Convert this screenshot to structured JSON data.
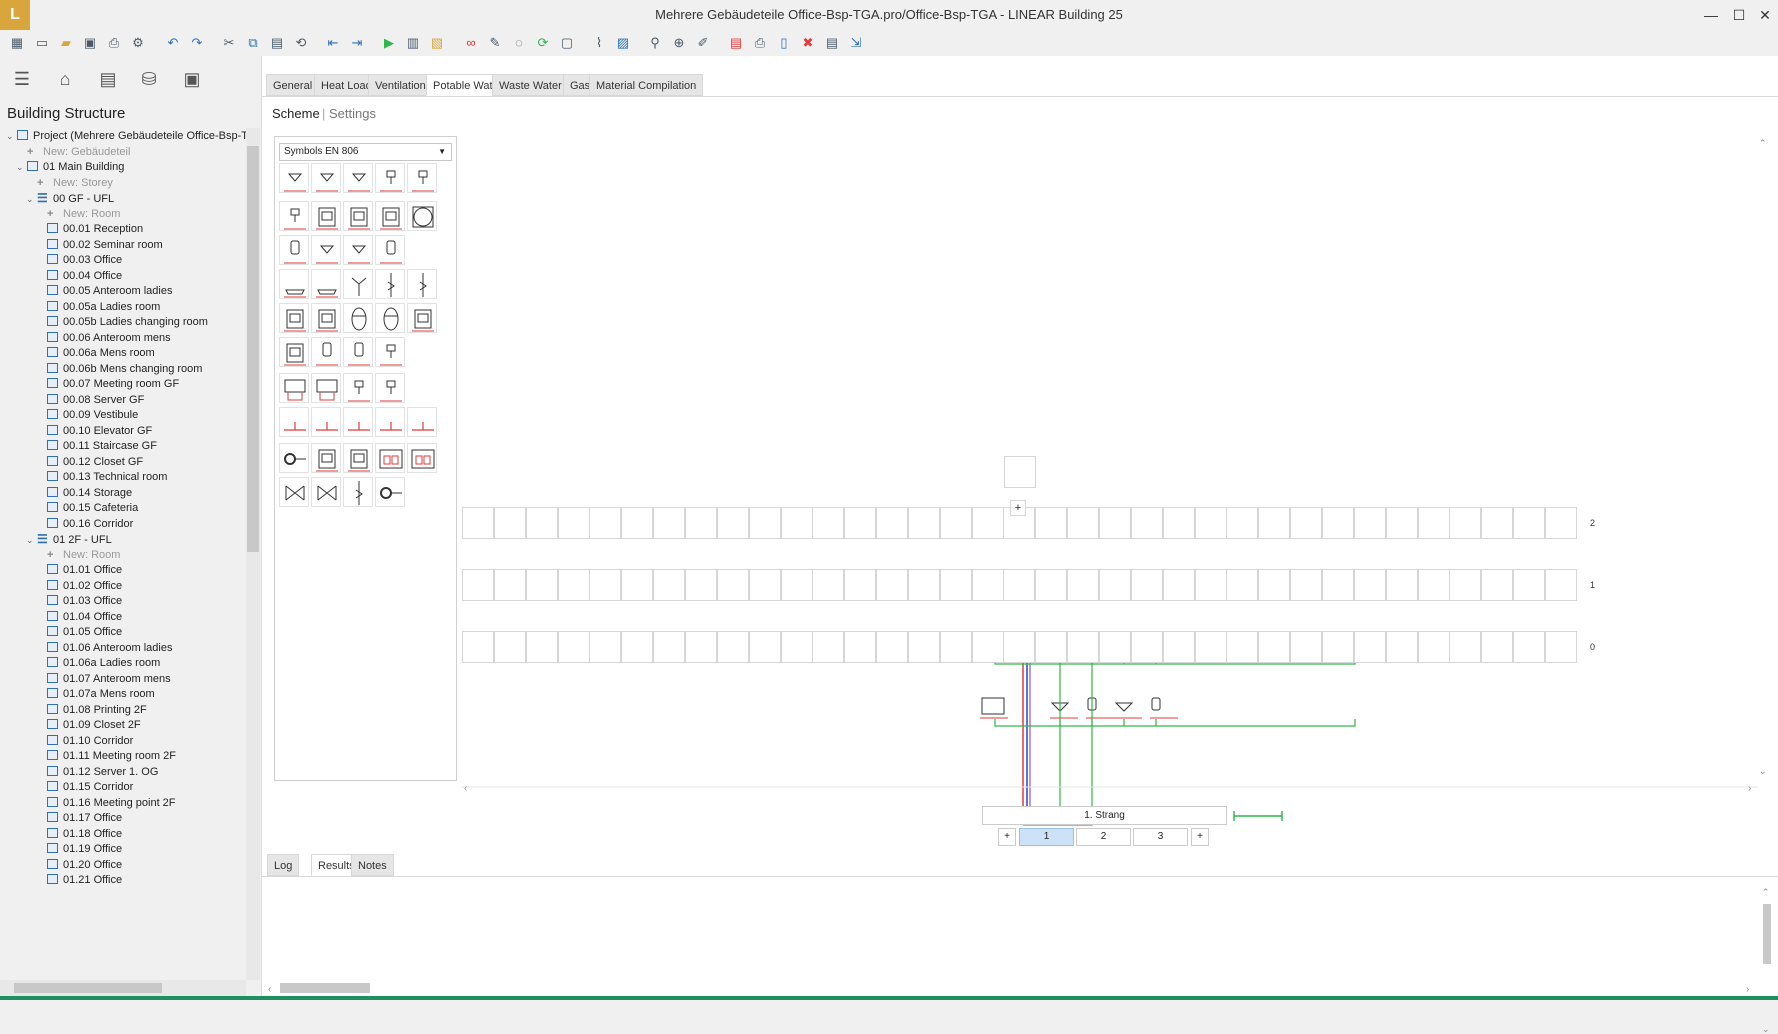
{
  "app": {
    "logo": "L",
    "title": "Mehrere Gebäudeteile Office-Bsp-TGA.pro/Office-Bsp-TGA - LINEAR Building 25"
  },
  "window": {
    "minimize": "—",
    "maximize": "☐",
    "close": "✕"
  },
  "toolbar_icons": [
    "apps-icon",
    "new-icon",
    "open-icon",
    "save-icon",
    "print-icon",
    "settings-icon",
    "undo-icon",
    "redo-icon",
    "cut-icon",
    "copy-icon",
    "paste-icon",
    "replace-icon",
    "import-icon",
    "export-icon",
    "run-icon",
    "calc-icon",
    "report-icon",
    "link-icon",
    "edit-icon",
    "check-icon",
    "refresh-icon",
    "delete-icon",
    "measure-icon",
    "layout-icon",
    "zoom-icon",
    "zoom-fit-icon",
    "pick-icon",
    "table-icon",
    "print2-icon",
    "pdf-icon",
    "doc-icon",
    "export2-icon"
  ],
  "left_panel": {
    "view_icons": [
      "menu-icon",
      "building-icon",
      "list-icon",
      "database-icon",
      "panel-icon"
    ],
    "title": "Building Structure",
    "tree": [
      {
        "level": 0,
        "type": "project",
        "label": "Project (Mehrere Gebäudeteile Office-Bsp-TG"
      },
      {
        "level": 1,
        "type": "new",
        "label": "New: Gebäudeteil"
      },
      {
        "level": 1,
        "type": "building",
        "label": "01 Main Building"
      },
      {
        "level": 2,
        "type": "new",
        "label": "New: Storey"
      },
      {
        "level": 2,
        "type": "storey",
        "label": "00 GF - UFL"
      },
      {
        "level": 3,
        "type": "new",
        "label": "New: Room"
      },
      {
        "level": 3,
        "type": "room",
        "label": "00.01 Reception"
      },
      {
        "level": 3,
        "type": "room",
        "label": "00.02 Seminar room"
      },
      {
        "level": 3,
        "type": "room",
        "label": "00.03 Office"
      },
      {
        "level": 3,
        "type": "room",
        "label": "00.04 Office"
      },
      {
        "level": 3,
        "type": "room",
        "label": "00.05 Anteroom ladies"
      },
      {
        "level": 3,
        "type": "room",
        "label": "00.05a Ladies room"
      },
      {
        "level": 3,
        "type": "room",
        "label": "00.05b Ladies changing room"
      },
      {
        "level": 3,
        "type": "room",
        "label": "00.06 Anteroom mens"
      },
      {
        "level": 3,
        "type": "room",
        "label": "00.06a Mens room"
      },
      {
        "level": 3,
        "type": "room",
        "label": "00.06b Mens changing room"
      },
      {
        "level": 3,
        "type": "room",
        "label": "00.07 Meeting room GF"
      },
      {
        "level": 3,
        "type": "room",
        "label": "00.08 Server GF"
      },
      {
        "level": 3,
        "type": "room",
        "label": "00.09 Vestibule"
      },
      {
        "level": 3,
        "type": "room",
        "label": "00.10 Elevator GF"
      },
      {
        "level": 3,
        "type": "room",
        "label": "00.11 Staircase GF"
      },
      {
        "level": 3,
        "type": "room",
        "label": "00.12 Closet GF"
      },
      {
        "level": 3,
        "type": "room",
        "label": "00.13 Technical room"
      },
      {
        "level": 3,
        "type": "room",
        "label": "00.14 Storage"
      },
      {
        "level": 3,
        "type": "room",
        "label": "00.15 Cafeteria"
      },
      {
        "level": 3,
        "type": "room",
        "label": "00.16 Corridor"
      },
      {
        "level": 2,
        "type": "storey",
        "label": "01 2F - UFL"
      },
      {
        "level": 3,
        "type": "new",
        "label": "New: Room"
      },
      {
        "level": 3,
        "type": "room",
        "label": "01.01 Office"
      },
      {
        "level": 3,
        "type": "room",
        "label": "01.02 Office"
      },
      {
        "level": 3,
        "type": "room",
        "label": "01.03 Office"
      },
      {
        "level": 3,
        "type": "room",
        "label": "01.04 Office"
      },
      {
        "level": 3,
        "type": "room",
        "label": "01.05 Office"
      },
      {
        "level": 3,
        "type": "room",
        "label": "01.06 Anteroom ladies"
      },
      {
        "level": 3,
        "type": "room",
        "label": "01.06a Ladies room"
      },
      {
        "level": 3,
        "type": "room",
        "label": "01.07 Anteroom mens"
      },
      {
        "level": 3,
        "type": "room",
        "label": "01.07a Mens room"
      },
      {
        "level": 3,
        "type": "room",
        "label": "01.08 Printing 2F"
      },
      {
        "level": 3,
        "type": "room",
        "label": "01.09 Closet 2F"
      },
      {
        "level": 3,
        "type": "room",
        "label": "01.10 Corridor"
      },
      {
        "level": 3,
        "type": "room",
        "label": "01.11 Meeting room 2F"
      },
      {
        "level": 3,
        "type": "room",
        "label": "01.12 Server 1. OG"
      },
      {
        "level": 3,
        "type": "room",
        "label": "01.15 Corridor"
      },
      {
        "level": 3,
        "type": "room",
        "label": "01.16 Meeting point 2F"
      },
      {
        "level": 3,
        "type": "room",
        "label": "01.17 Office"
      },
      {
        "level": 3,
        "type": "room",
        "label": "01.18 Office"
      },
      {
        "level": 3,
        "type": "room",
        "label": "01.19 Office"
      },
      {
        "level": 3,
        "type": "room",
        "label": "01.20 Office"
      },
      {
        "level": 3,
        "type": "room",
        "label": "01.21 Office"
      }
    ]
  },
  "tabs": [
    "General",
    "Heat Load",
    "Ventilation",
    "Potable Water",
    "Waste Water",
    "Gas",
    "Material Compilation"
  ],
  "active_tab": "Potable Water",
  "subtabs": {
    "scheme": "Scheme",
    "sep": "|",
    "settings": "Settings"
  },
  "palette": {
    "select": "Symbols EN 806"
  },
  "scheme": {
    "levels": [
      "2",
      "1",
      "0"
    ],
    "strang": "1. Strang",
    "pages": [
      "1",
      "2",
      "3"
    ],
    "add": "+",
    "colors": {
      "cold": "#2b3fd6",
      "hot": "#e23a3a",
      "circ": "#7a2fb5",
      "branch": "#2db84a"
    }
  },
  "bottom_tabs": [
    "Log",
    "Results",
    "Notes"
  ],
  "active_bottom_tab": "Results"
}
